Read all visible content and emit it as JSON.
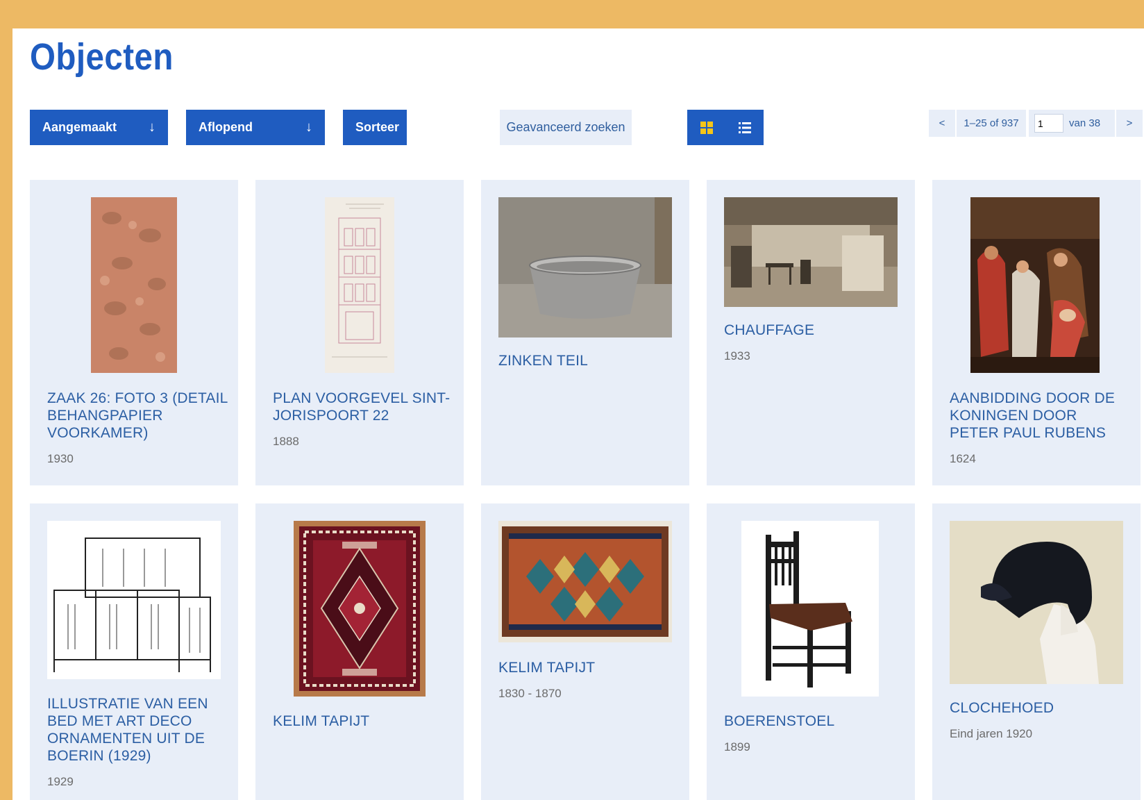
{
  "page": {
    "title": "Objecten"
  },
  "toolbar": {
    "sort_field": "Aangemaakt",
    "sort_order": "Aflopend",
    "sort_button": "Sorteer",
    "advanced_search": "Geavanceerd zoeken",
    "arrow": "↓"
  },
  "pagination": {
    "prev": "<",
    "range": "1–25 of 937",
    "page_value": "1",
    "of_pages": "van 38",
    "next": ">"
  },
  "colors": {
    "accent": "#1f5cc0",
    "frame": "#edb964",
    "card": "#e8eef8",
    "toggle_active": "#f5c518"
  },
  "cards": [
    {
      "title": "ZAAK 26: FOTO 3 (DETAIL BEHANGPAPIER VOORKAMER)",
      "date": "1930",
      "image": "wallpaper-photo"
    },
    {
      "title": "PLAN VOORGEVEL SINT-JORISPOORT 22",
      "date": "1888",
      "image": "facade-plan-drawing"
    },
    {
      "title": "ZINKEN TEIL",
      "date": "",
      "image": "zinc-tub-photo"
    },
    {
      "title": "CHAUFFAGE",
      "date": "1933",
      "image": "interior-photo"
    },
    {
      "title": "AANBIDDING DOOR DE KONINGEN DOOR PETER PAUL RUBENS",
      "date": "1624",
      "image": "rubens-painting"
    },
    {
      "title": "ILLUSTRATIE VAN EEN BED MET ART DECO ORNAMENTEN UIT DE BOERIN (1929)",
      "date": "1929",
      "image": "art-deco-bed-illustration"
    },
    {
      "title": "KELIM TAPIJT",
      "date": "",
      "image": "red-rug-photo"
    },
    {
      "title": "KELIM TAPIJT",
      "date": "1830 - 1870",
      "image": "kilim-rug-photo"
    },
    {
      "title": "BOERENSTOEL",
      "date": "1899",
      "image": "farm-chair-photo"
    },
    {
      "title": "CLOCHEHOED",
      "date": "Eind jaren 1920",
      "image": "cloche-hat-photo"
    }
  ]
}
